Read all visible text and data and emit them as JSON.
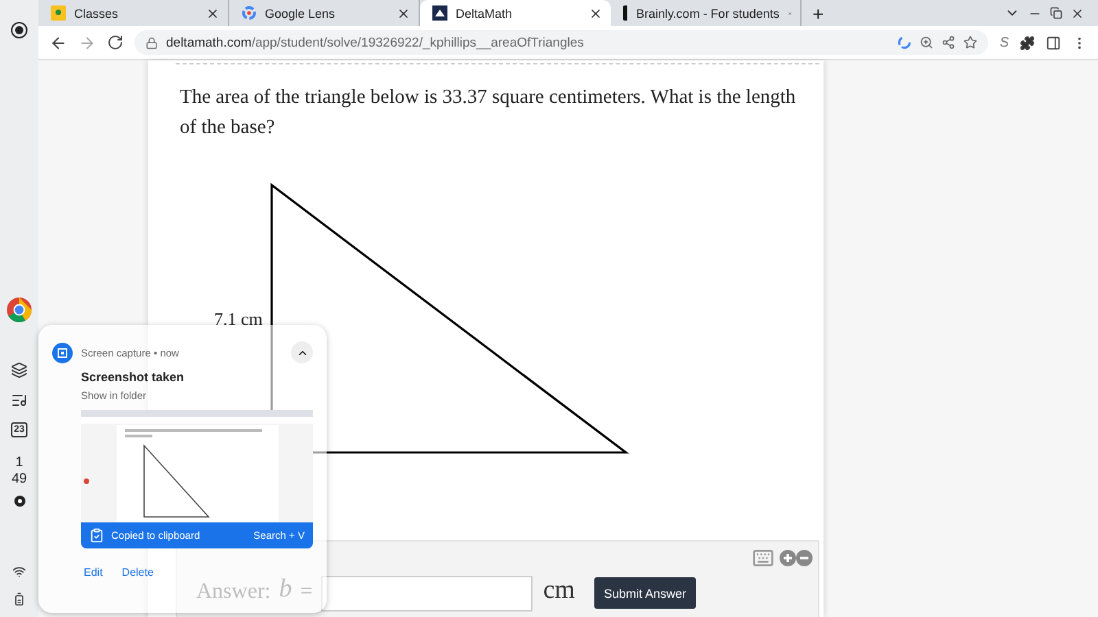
{
  "tabs": [
    {
      "title": "Classes",
      "selected": false
    },
    {
      "title": "Google Lens",
      "selected": false
    },
    {
      "title": "DeltaMath",
      "selected": true
    },
    {
      "title": "Brainly.com - For students",
      "selected": false
    }
  ],
  "new_tab": "+",
  "address": {
    "url_host": "deltamath.com",
    "url_path": "/app/student/solve/19326922/_kphillips__areaOfTriangles"
  },
  "extension_label": "S",
  "question": "The area of the triangle below is 33.37 square centimeters. What is the length of the base?",
  "figure": {
    "height_label": "7.1 cm"
  },
  "answer": {
    "prefix": "Answer:",
    "variable": "b",
    "equals": "=",
    "unit": "cm",
    "button": "Submit Answer"
  },
  "notification": {
    "source": "Screen capture",
    "separator": "•",
    "time": "now",
    "title": "Screenshot taken",
    "link": "Show in folder",
    "banner": "Copied to clipboard",
    "shortcut": "Search + V",
    "actions": [
      "Edit",
      "Delete"
    ]
  },
  "shelf": {
    "calendar_date": "23",
    "clock_hours": "1",
    "clock_minutes": "49"
  }
}
